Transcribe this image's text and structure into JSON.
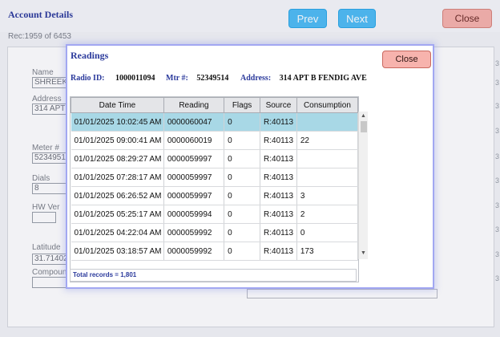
{
  "main_window": {
    "title": "Account Details",
    "prev_label": "Prev",
    "next_label": "Next",
    "close_label": "Close",
    "record_info": "Rec:1959 of 6453",
    "fields": {
      "name_label": "Name",
      "name_value": "SHREEKA",
      "address_label": "Address",
      "address_value": "314 APT B",
      "meter_label": "Meter #",
      "meter_value": "52349514",
      "dials_label": "Dials",
      "dials_value": "8",
      "hw_ver_label": "HW Ver",
      "hw_ver_value": "",
      "latitude_label": "Latitude",
      "latitude_value": "31.71402",
      "compound_label": "Compound",
      "compound_value": ""
    },
    "edge_number": "3"
  },
  "readings_dialog": {
    "title": "Readings",
    "close_label": "Close",
    "radio_id_label": "Radio ID:",
    "radio_id_value": "1000011094",
    "mtr_label": "Mtr #:",
    "mtr_value": "52349514",
    "address_label": "Address:",
    "address_value": "314 APT B FENDIG AVE",
    "columns": [
      "Date Time",
      "Reading",
      "Flags",
      "Source",
      "Consumption"
    ],
    "rows": [
      {
        "datetime": "01/01/2025 10:02:45 AM",
        "reading": "0000060047",
        "flags": "0",
        "source": "R:40113",
        "consumption": "",
        "selected": true
      },
      {
        "datetime": "01/01/2025 09:00:41 AM",
        "reading": "0000060019",
        "flags": "0",
        "source": "R:40113",
        "consumption": "22",
        "selected": false
      },
      {
        "datetime": "01/01/2025 08:29:27 AM",
        "reading": "0000059997",
        "flags": "0",
        "source": "R:40113",
        "consumption": "",
        "selected": false
      },
      {
        "datetime": "01/01/2025 07:28:17 AM",
        "reading": "0000059997",
        "flags": "0",
        "source": "R:40113",
        "consumption": "",
        "selected": false
      },
      {
        "datetime": "01/01/2025 06:26:52 AM",
        "reading": "0000059997",
        "flags": "0",
        "source": "R:40113",
        "consumption": "3",
        "selected": false
      },
      {
        "datetime": "01/01/2025 05:25:17 AM",
        "reading": "0000059994",
        "flags": "0",
        "source": "R:40113",
        "consumption": "2",
        "selected": false
      },
      {
        "datetime": "01/01/2025 04:22:04 AM",
        "reading": "0000059992",
        "flags": "0",
        "source": "R:40113",
        "consumption": "0",
        "selected": false
      },
      {
        "datetime": "01/01/2025 03:18:57 AM",
        "reading": "0000059992",
        "flags": "0",
        "source": "R:40113",
        "consumption": "173",
        "selected": false
      }
    ],
    "total_records": "Total records = 1,801"
  },
  "colors": {
    "title_blue": "#2b3a9c",
    "nav_button": "#4fbdf5",
    "close_button": "#f7b3ad",
    "selected_row": "#a8d8e6"
  }
}
